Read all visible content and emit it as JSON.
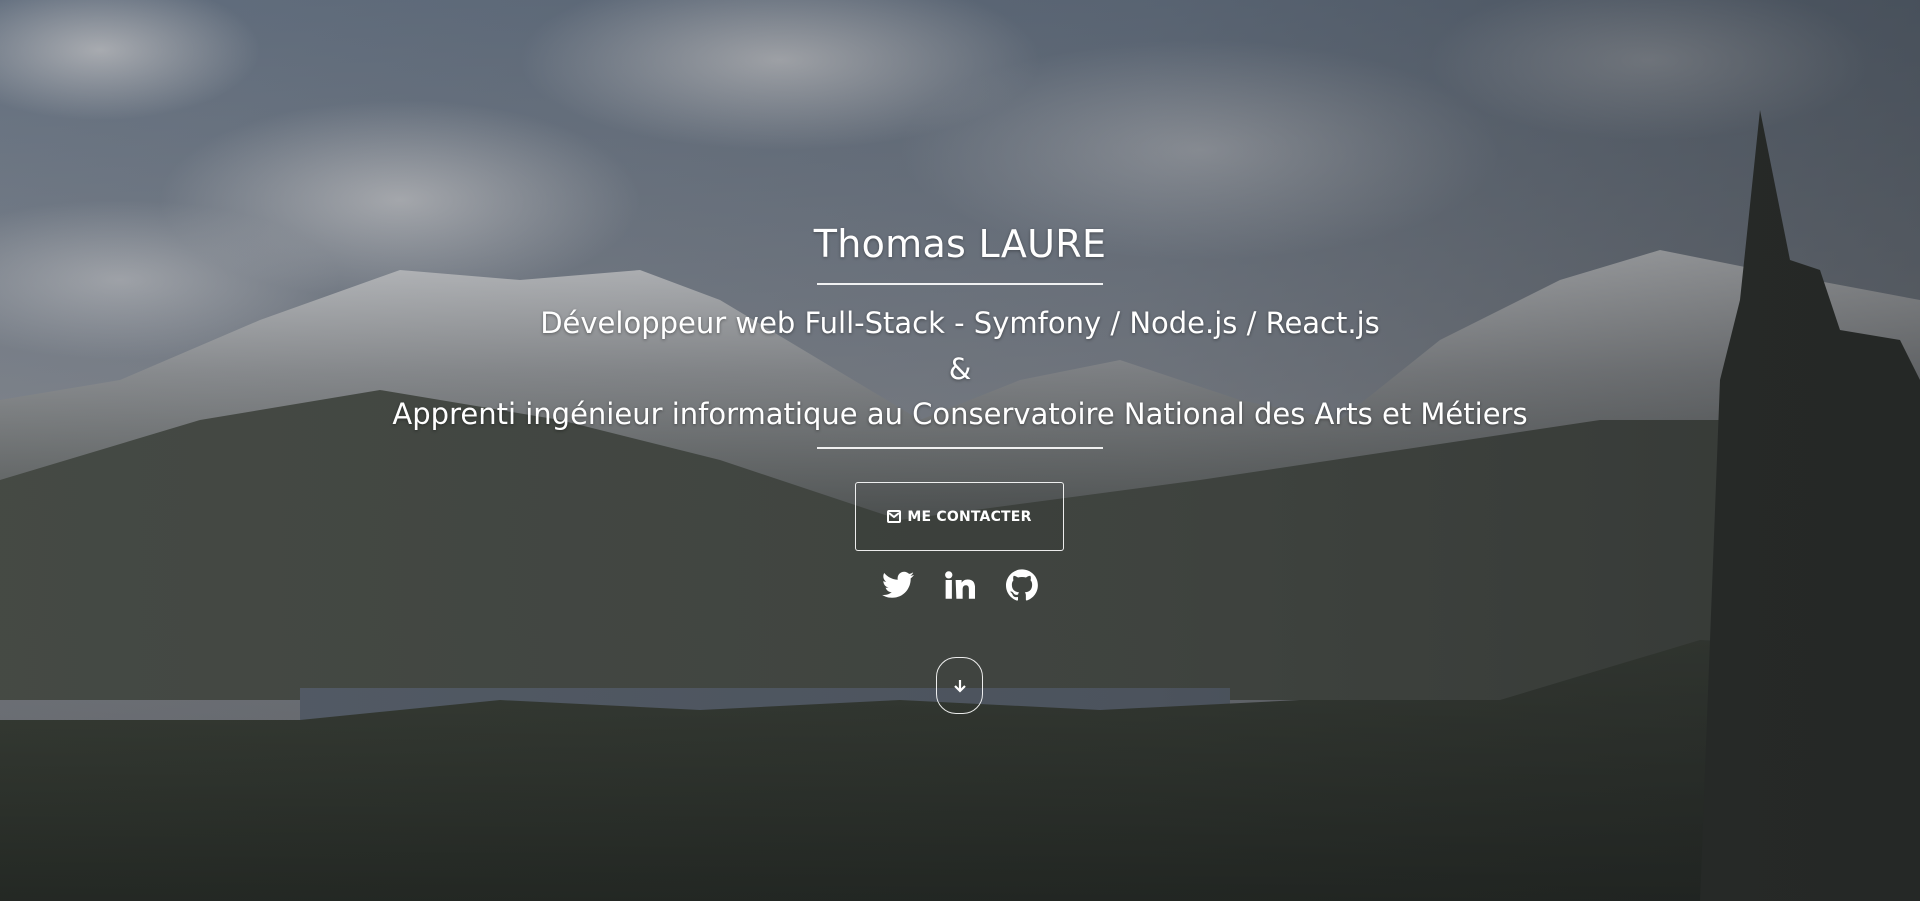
{
  "hero": {
    "title": "Thomas LAURE",
    "subtitle_line1": "Développeur web Full-Stack - Symfony / Node.js / React.js",
    "subtitle_line2": "&",
    "subtitle_line3": "Apprenti ingénieur informatique au Conservatoire National des Arts et Métiers",
    "contact_button": {
      "label": "ME CONTACTER",
      "icon": "envelope-icon"
    },
    "social_links": [
      {
        "name": "Twitter",
        "icon": "twitter-icon"
      },
      {
        "name": "LinkedIn",
        "icon": "linkedin-icon"
      },
      {
        "name": "GitHub",
        "icon": "github-icon"
      }
    ],
    "scroll_button": {
      "icon": "arrow-down-icon"
    }
  },
  "colors": {
    "text": "#ffffff",
    "overlay": "#2a2c30",
    "sky": "#7d8795",
    "forest": "#2b3128"
  }
}
